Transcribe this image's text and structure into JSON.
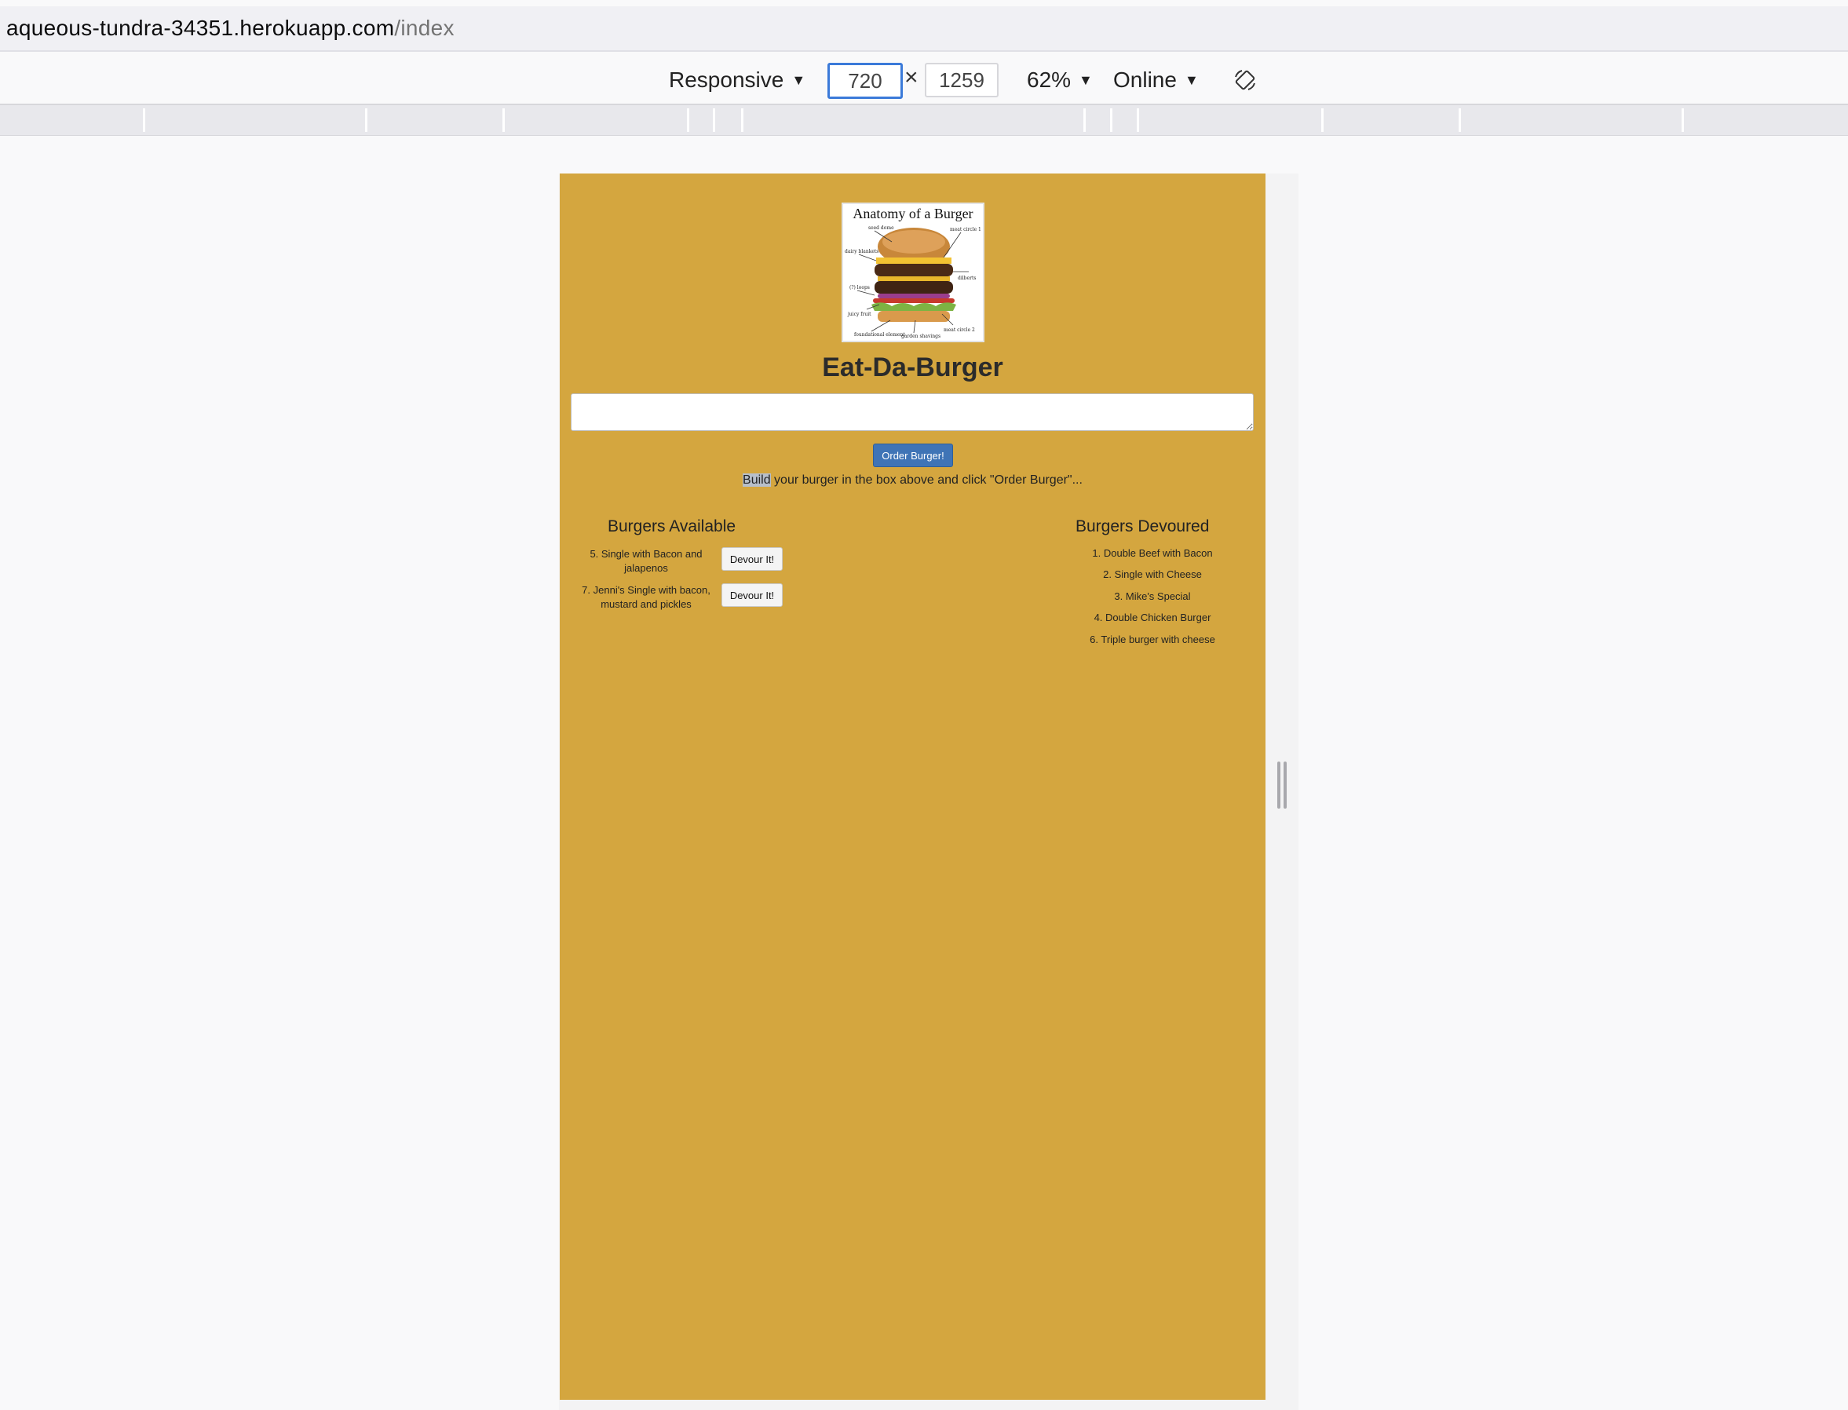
{
  "browser": {
    "url_host": "aqueous-tundra-34351.herokuapp.com",
    "url_path": "/index"
  },
  "device_toolbar": {
    "preset": "Responsive",
    "width": "720",
    "height": "1259",
    "zoom": "62%",
    "network": "Online",
    "caret": "▼",
    "times": "×",
    "rotate_icon": "rotate-icon"
  },
  "page": {
    "background_color": "#d4a63f",
    "hero_image_title": "Anatomy of a Burger",
    "hero_labels": [
      "seed dome",
      "meat circle 1",
      "dairy blankets",
      "dilberts",
      "(?) loops",
      "juicy fruit",
      "foundational element",
      "garden shavings",
      "meat circle 2"
    ],
    "title": "Eat-Da-Burger",
    "input_value": "",
    "order_button": "Order Burger!",
    "instructions_highlight": "Build",
    "instructions_rest": " your burger in the box above and click \"Order Burger\"...",
    "available": {
      "heading": "Burgers Available",
      "items": [
        {
          "label": "5. Single with Bacon and jalapenos",
          "button": "Devour It!"
        },
        {
          "label": "7. Jenni's Single with bacon, mustard and pickles",
          "button": "Devour It!"
        }
      ]
    },
    "devoured": {
      "heading": "Burgers Devoured",
      "items": [
        "1. Double Beef with Bacon",
        "2. Single with Cheese",
        "3. Mike's Special",
        "4. Double Chicken Burger",
        "6. Triple burger with cheese"
      ]
    },
    "accent_button_color": "#3f74b6"
  }
}
